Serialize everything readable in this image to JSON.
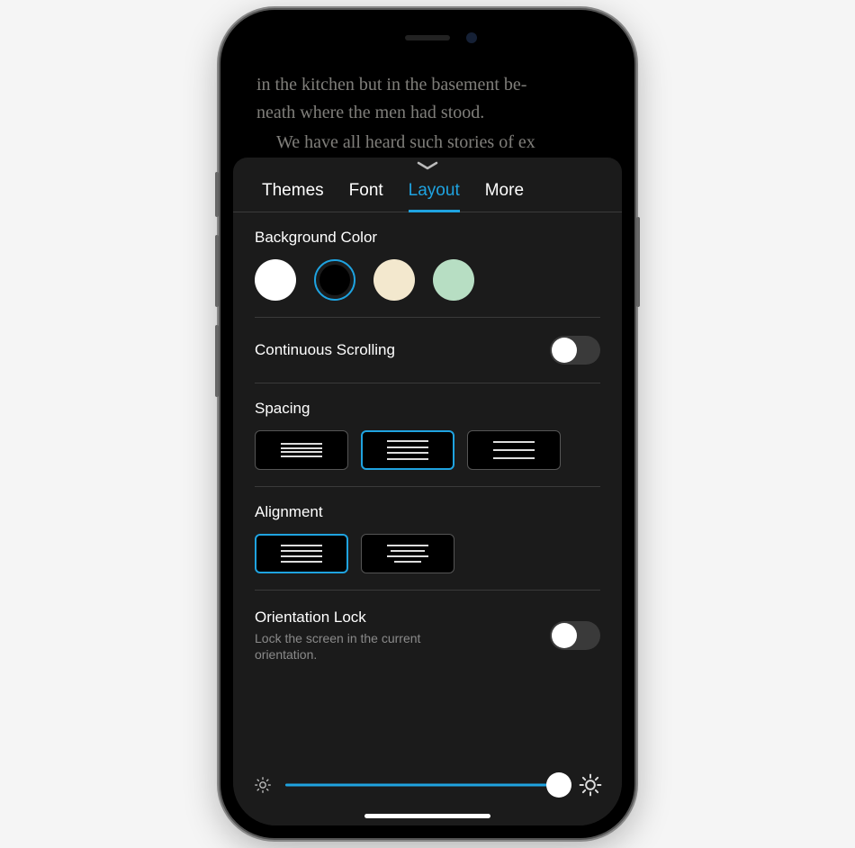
{
  "book": {
    "line1": "in the kitchen but in the basement be-",
    "line2": "neath where the men had stood.",
    "line3": "We have all heard such stories of ex"
  },
  "tabs": {
    "themes": "Themes",
    "font": "Font",
    "layout": "Layout",
    "more": "More",
    "active": "layout"
  },
  "sections": {
    "background": {
      "title": "Background Color",
      "options": [
        "white",
        "black",
        "sepia",
        "mint"
      ],
      "selected": "black"
    },
    "continuous_scrolling": {
      "title": "Continuous Scrolling",
      "enabled": false
    },
    "spacing": {
      "title": "Spacing",
      "options": [
        "tight",
        "medium",
        "wide"
      ],
      "selected": "medium"
    },
    "alignment": {
      "title": "Alignment",
      "options": [
        "justify",
        "left"
      ],
      "selected": "justify"
    },
    "orientation": {
      "title": "Orientation Lock",
      "description": "Lock the screen in the current orientation.",
      "enabled": false
    }
  },
  "brightness": {
    "value": 0.95
  }
}
